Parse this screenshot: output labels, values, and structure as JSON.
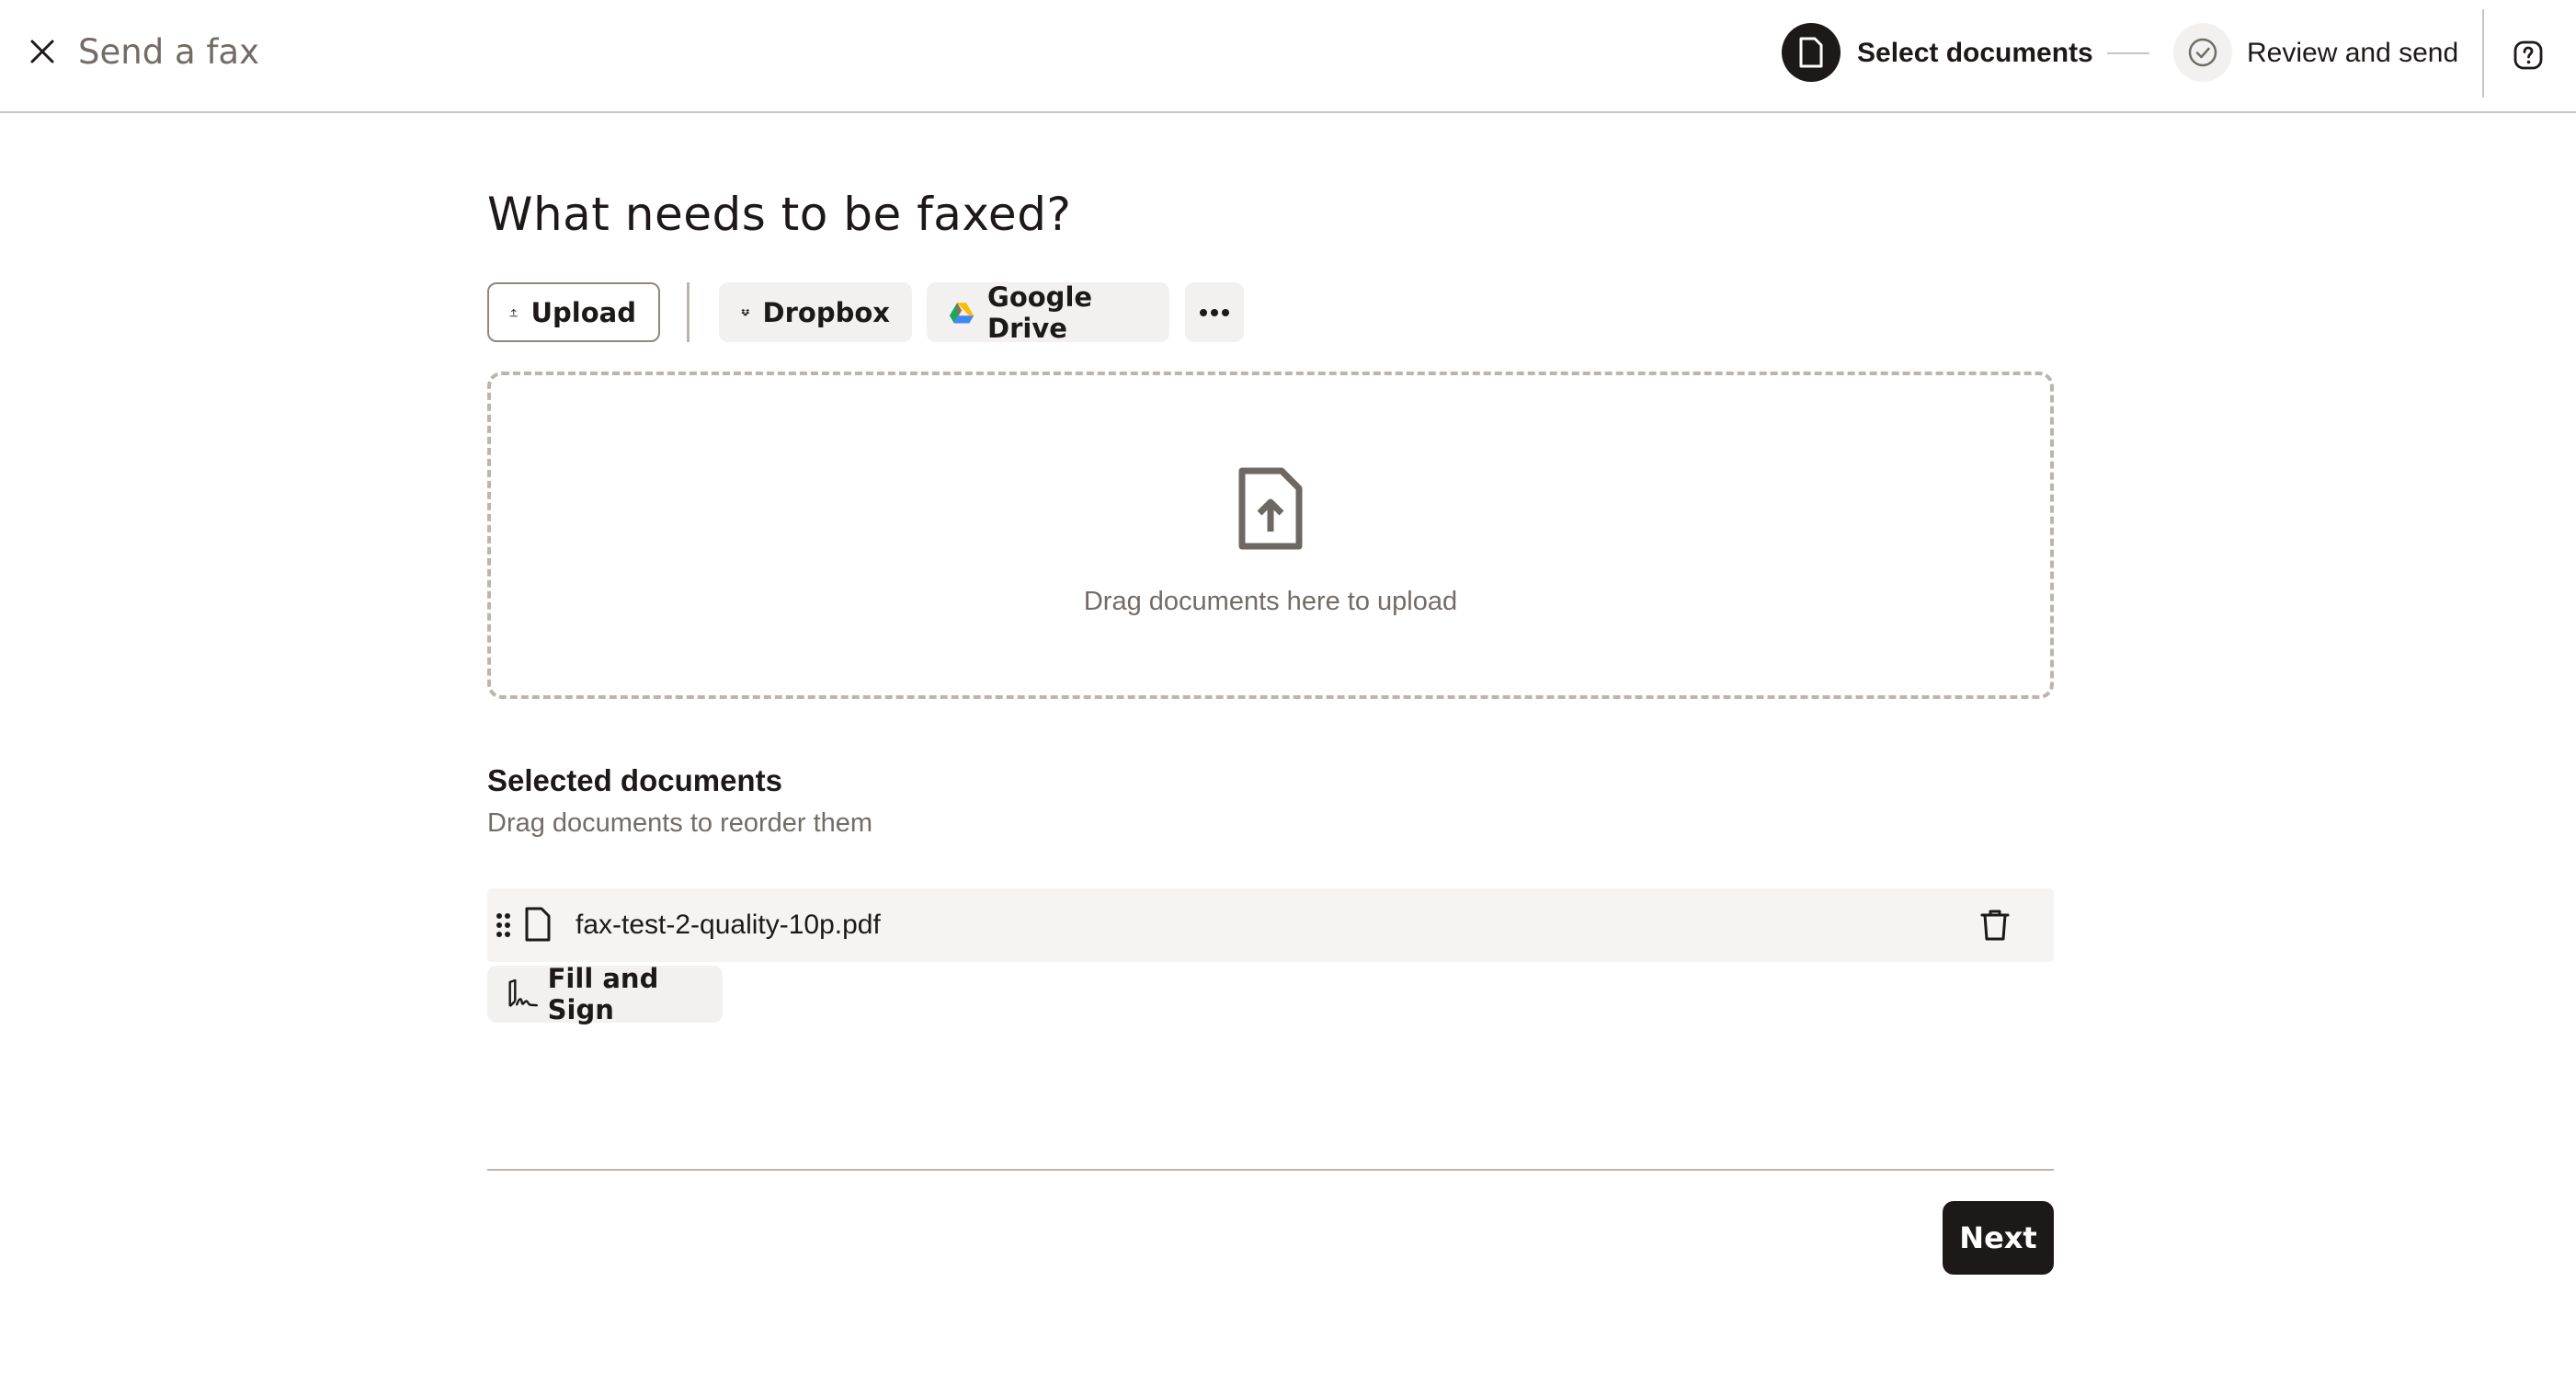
{
  "header": {
    "title": "Send a fax",
    "close_icon": "close-icon",
    "help_icon": "help-icon",
    "steps": [
      {
        "label": "Select documents",
        "icon": "document-icon",
        "state": "active"
      },
      {
        "label": "Review and send",
        "icon": "check-circle-icon",
        "state": "pending"
      }
    ]
  },
  "main": {
    "heading": "What needs to be faxed?",
    "sources": {
      "upload_label": "Upload",
      "dropbox_label": "Dropbox",
      "gdrive_label": "Google Drive",
      "more_icon": "more-horizontal-icon"
    },
    "dropzone": {
      "icon": "file-upload-icon",
      "text": "Drag documents here to upload"
    },
    "selected": {
      "heading": "Selected documents",
      "subtext": "Drag documents to reorder them",
      "documents": [
        {
          "name": "fax-test-2-quality-10p.pdf",
          "icon": "document-icon"
        }
      ],
      "fill_sign_label": "Fill and Sign"
    }
  },
  "footer": {
    "next_label": "Next"
  },
  "colors": {
    "primary_dark": "#1e1919",
    "secondary_text": "#736c64",
    "button_bg": "#f2f1ef",
    "row_bg": "#f5f4f2",
    "border": "#bbb5ae"
  }
}
